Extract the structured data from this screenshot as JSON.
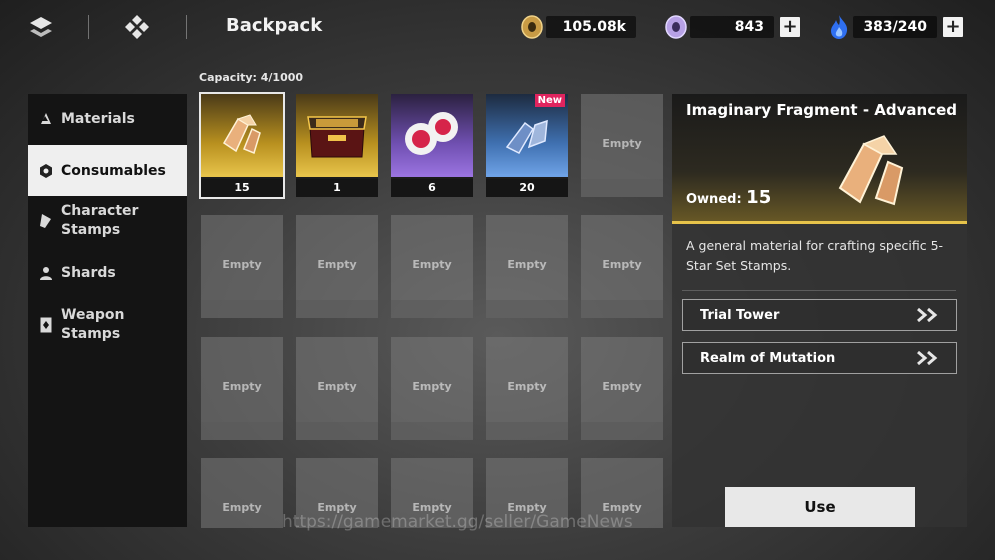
{
  "header": {
    "title": "Backpack",
    "menu_icon": "menu-diamonds-icon",
    "home_icon": "four-diamond-icon"
  },
  "currencies": [
    {
      "name": "gold-coin",
      "icon": "gold-coin-icon",
      "value": "105.08k",
      "has_plus": false,
      "color": "#d9b25a"
    },
    {
      "name": "premium-gem",
      "icon": "prism-gem-icon",
      "value": "843",
      "has_plus": true,
      "color": "#b99be8"
    },
    {
      "name": "stamina",
      "icon": "blue-flame-icon",
      "value": "383/240",
      "has_plus": true,
      "color": "#3f7ef0"
    }
  ],
  "capacity": "Capacity: 4/1000",
  "sidebar": {
    "items": [
      {
        "label": "Materials",
        "icon": "flask-icon",
        "active": false
      },
      {
        "label": "Consumables",
        "icon": "hexagon-icon",
        "active": true
      },
      {
        "label": "Character\nStamps",
        "icon": "pen-nib-icon",
        "active": false
      },
      {
        "label": "Shards",
        "icon": "person-icon",
        "active": false
      },
      {
        "label": "Weapon\nStamps",
        "icon": "card-icon",
        "active": false
      }
    ]
  },
  "inventory": {
    "empty_label": "Empty",
    "items": [
      {
        "name": "Imaginary Fragment - Advanced",
        "count": "15",
        "rarity": "gold",
        "selected": true,
        "new": false
      },
      {
        "name": "Treasure Chest",
        "count": "1",
        "rarity": "gold",
        "selected": false,
        "new": false
      },
      {
        "name": "Red Spheres",
        "count": "6",
        "rarity": "purple",
        "selected": false,
        "new": false
      },
      {
        "name": "Blue Fragment",
        "count": "20",
        "rarity": "blue",
        "selected": false,
        "new": true
      }
    ],
    "new_badge": "New"
  },
  "detail": {
    "title": "Imaginary Fragment - Advanced",
    "owned_label": "Owned:",
    "owned_value": "15",
    "description": "A general material for crafting specific 5-Star Set Stamps.",
    "sources": [
      {
        "label": "Trial Tower"
      },
      {
        "label": "Realm of Mutation"
      }
    ],
    "use_label": "Use"
  },
  "watermark": "https://gamemarket.gg/seller/GameNews"
}
